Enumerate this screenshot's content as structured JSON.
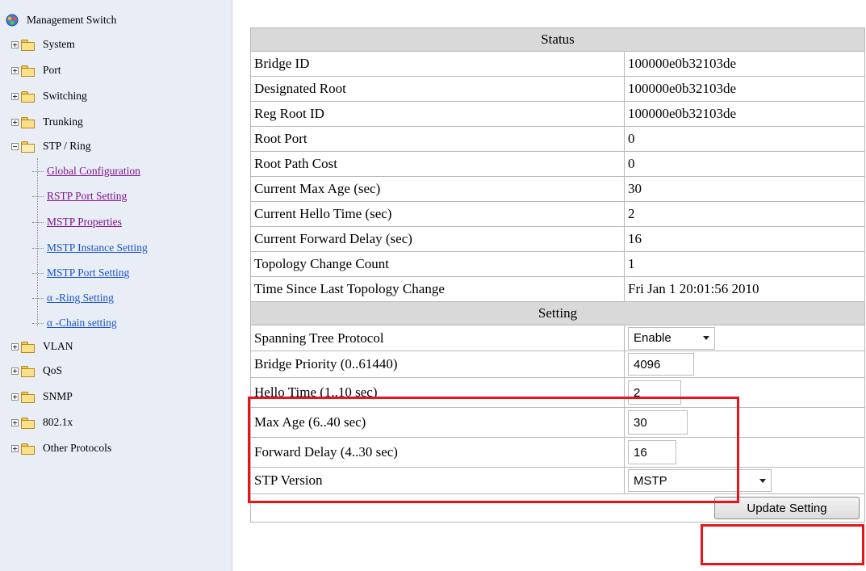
{
  "sidebar": {
    "root_label": "Management Switch",
    "nodes": [
      {
        "label": "System",
        "expanded": false
      },
      {
        "label": "Port",
        "expanded": false
      },
      {
        "label": "Switching",
        "expanded": false
      },
      {
        "label": "Trunking",
        "expanded": false
      },
      {
        "label": "STP / Ring",
        "expanded": true
      },
      {
        "label": "VLAN",
        "expanded": false
      },
      {
        "label": "QoS",
        "expanded": false
      },
      {
        "label": "SNMP",
        "expanded": false
      },
      {
        "label": "802.1x",
        "expanded": false
      },
      {
        "label": "Other Protocols",
        "expanded": false
      }
    ],
    "stp_children": [
      {
        "label": "Global Configuration",
        "visited": true
      },
      {
        "label": "RSTP Port Setting",
        "visited": true
      },
      {
        "label": "MSTP Properties",
        "visited": true
      },
      {
        "label": "MSTP Instance Setting",
        "visited": false
      },
      {
        "label": "MSTP Port Setting",
        "visited": false
      },
      {
        "label": "α -Ring Setting",
        "visited": false
      },
      {
        "label": "α -Chain setting",
        "visited": false
      }
    ]
  },
  "status": {
    "header": "Status",
    "rows": [
      {
        "label": "Bridge ID",
        "value": "100000e0b32103de"
      },
      {
        "label": "Designated Root",
        "value": "100000e0b32103de"
      },
      {
        "label": "Reg Root ID",
        "value": "100000e0b32103de"
      },
      {
        "label": "Root Port",
        "value": "0"
      },
      {
        "label": "Root Path Cost",
        "value": "0"
      },
      {
        "label": "Current Max Age (sec)",
        "value": "30"
      },
      {
        "label": "Current Hello Time (sec)",
        "value": "2"
      },
      {
        "label": "Current Forward Delay (sec)",
        "value": "16"
      },
      {
        "label": "Topology Change Count",
        "value": "1"
      },
      {
        "label": "Time Since Last Topology Change",
        "value": "Fri Jan 1 20:01:56 2010"
      }
    ]
  },
  "setting": {
    "header": "Setting",
    "stp_label": "Spanning Tree Protocol",
    "stp_value": "Enable",
    "priority_label": "Bridge Priority (0..61440)",
    "priority_value": "4096",
    "hello_label": "Hello Time (1..10 sec)",
    "hello_value": "2",
    "maxage_label": "Max Age (6..40 sec)",
    "maxage_value": "30",
    "fwd_label": "Forward Delay (4..30 sec)",
    "fwd_value": "16",
    "version_label": "STP Version",
    "version_value": "MSTP",
    "update_button": "Update Setting"
  },
  "colors": {
    "highlight": "#e8141c",
    "section_bg": "#d9d9d9",
    "sidebar_bg": "#e9edf6",
    "link": "#1a56c9",
    "visited_link": "#80148f"
  },
  "icons": [
    "switch-root-icon",
    "folder-icon",
    "folder-open-icon",
    "expand-plus-icon",
    "collapse-minus-icon",
    "dropdown-caret-icon"
  ]
}
